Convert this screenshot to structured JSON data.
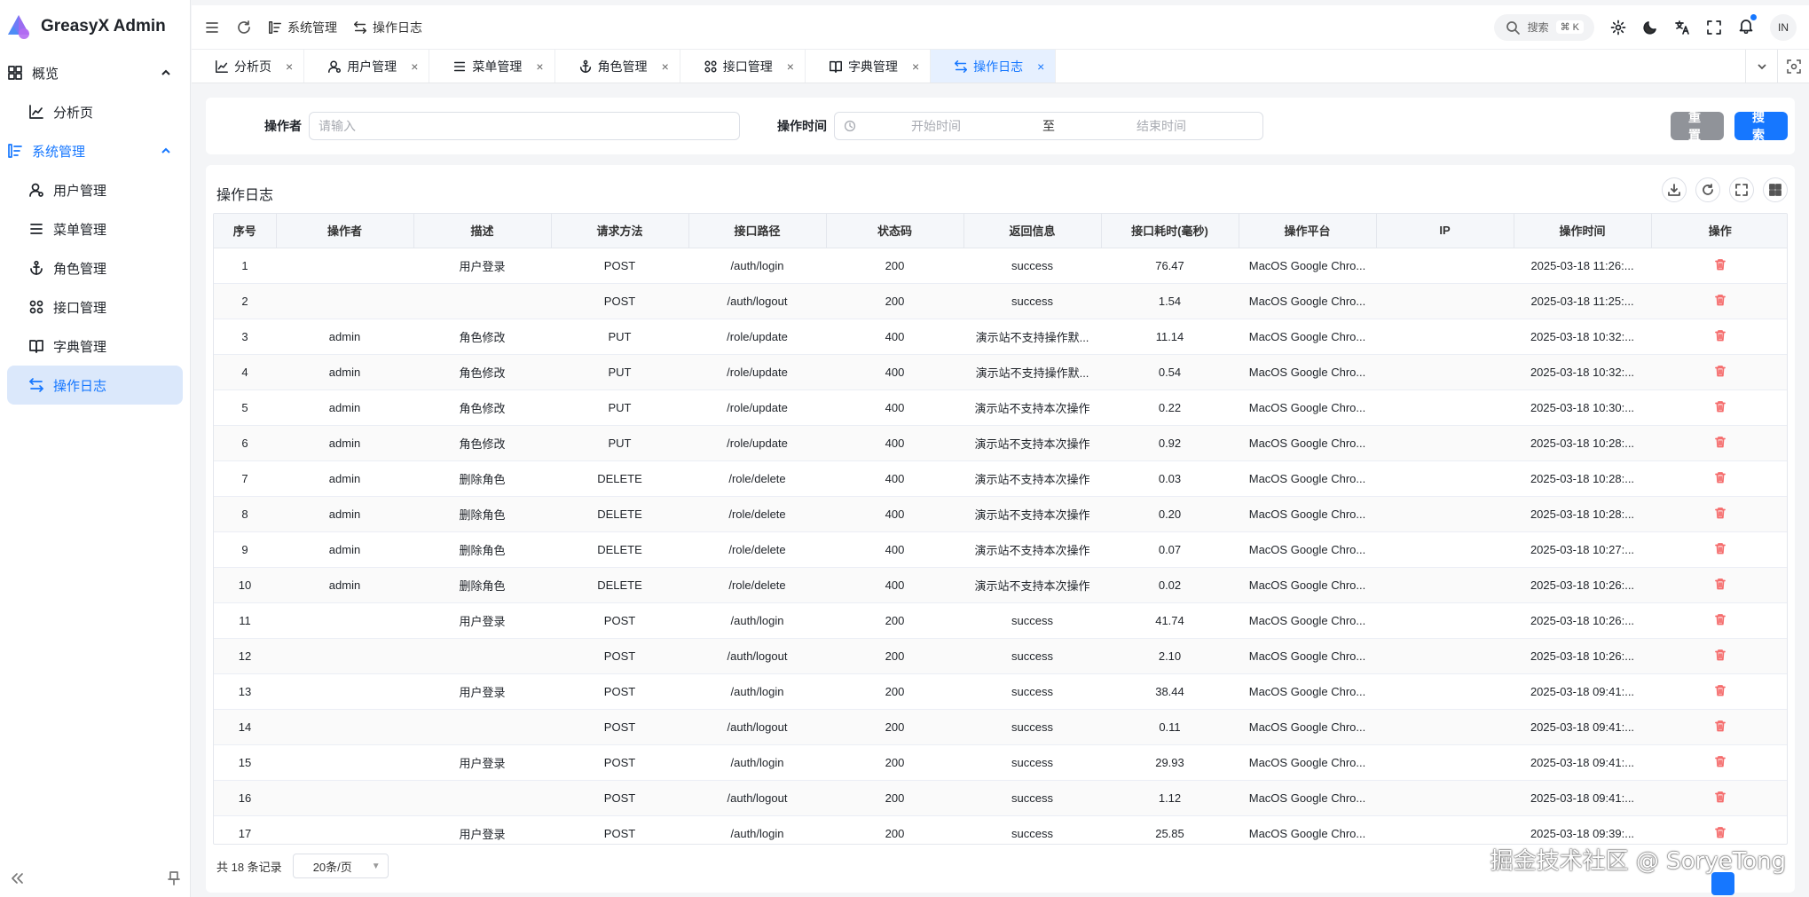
{
  "brand": {
    "name": "GreasyX Admin"
  },
  "sidebar": {
    "groups": [
      {
        "label": "概览",
        "icon": "dashboard-icon",
        "children": [
          {
            "label": "分析页",
            "icon": "chart-icon"
          }
        ]
      },
      {
        "label": "系统管理",
        "icon": "settings-list-icon",
        "children": [
          {
            "label": "用户管理",
            "icon": "user-icon"
          },
          {
            "label": "菜单管理",
            "icon": "menu-icon"
          },
          {
            "label": "角色管理",
            "icon": "anchor-icon"
          },
          {
            "label": "接口管理",
            "icon": "api-icon"
          },
          {
            "label": "字典管理",
            "icon": "book-icon"
          },
          {
            "label": "操作日志",
            "icon": "swap-icon"
          }
        ]
      }
    ]
  },
  "header": {
    "breadcrumb": [
      "系统管理",
      "操作日志"
    ],
    "search_label": "搜索",
    "search_shortcut": "⌘ K",
    "avatar_text": "IN"
  },
  "tabs": [
    {
      "label": "分析页",
      "icon": "chart-icon"
    },
    {
      "label": "用户管理",
      "icon": "user-icon"
    },
    {
      "label": "菜单管理",
      "icon": "menu-icon"
    },
    {
      "label": "角色管理",
      "icon": "anchor-icon"
    },
    {
      "label": "接口管理",
      "icon": "api-icon"
    },
    {
      "label": "字典管理",
      "icon": "book-icon"
    },
    {
      "label": "操作日志",
      "icon": "swap-icon",
      "active": true
    }
  ],
  "form": {
    "operator_label": "操作者",
    "operator_placeholder": "请输入",
    "time_label": "操作时间",
    "start_placeholder": "开始时间",
    "range_sep": "至",
    "end_placeholder": "结束时间",
    "reset_label": "重置",
    "search_label": "搜索"
  },
  "table": {
    "title": "操作日志",
    "columns": [
      "序号",
      "操作者",
      "描述",
      "请求方法",
      "接口路径",
      "状态码",
      "返回信息",
      "接口耗时(毫秒)",
      "操作平台",
      "IP",
      "操作时间",
      "操作"
    ],
    "rows": [
      [
        "1",
        "",
        "用户登录",
        "POST",
        "/auth/login",
        "200",
        "success",
        "76.47",
        "MacOS Google Chro...",
        "",
        "2025-03-18 11:26:..."
      ],
      [
        "2",
        "",
        "",
        "POST",
        "/auth/logout",
        "200",
        "success",
        "1.54",
        "MacOS Google Chro...",
        "",
        "2025-03-18 11:25:..."
      ],
      [
        "3",
        "admin",
        "角色修改",
        "PUT",
        "/role/update",
        "400",
        "演示站不支持操作默...",
        "11.14",
        "MacOS Google Chro...",
        "",
        "2025-03-18 10:32:..."
      ],
      [
        "4",
        "admin",
        "角色修改",
        "PUT",
        "/role/update",
        "400",
        "演示站不支持操作默...",
        "0.54",
        "MacOS Google Chro...",
        "",
        "2025-03-18 10:32:..."
      ],
      [
        "5",
        "admin",
        "角色修改",
        "PUT",
        "/role/update",
        "400",
        "演示站不支持本次操作",
        "0.22",
        "MacOS Google Chro...",
        "",
        "2025-03-18 10:30:..."
      ],
      [
        "6",
        "admin",
        "角色修改",
        "PUT",
        "/role/update",
        "400",
        "演示站不支持本次操作",
        "0.92",
        "MacOS Google Chro...",
        "",
        "2025-03-18 10:28:..."
      ],
      [
        "7",
        "admin",
        "删除角色",
        "DELETE",
        "/role/delete",
        "400",
        "演示站不支持本次操作",
        "0.03",
        "MacOS Google Chro...",
        "",
        "2025-03-18 10:28:..."
      ],
      [
        "8",
        "admin",
        "删除角色",
        "DELETE",
        "/role/delete",
        "400",
        "演示站不支持本次操作",
        "0.20",
        "MacOS Google Chro...",
        "",
        "2025-03-18 10:28:..."
      ],
      [
        "9",
        "admin",
        "删除角色",
        "DELETE",
        "/role/delete",
        "400",
        "演示站不支持本次操作",
        "0.07",
        "MacOS Google Chro...",
        "",
        "2025-03-18 10:27:..."
      ],
      [
        "10",
        "admin",
        "删除角色",
        "DELETE",
        "/role/delete",
        "400",
        "演示站不支持本次操作",
        "0.02",
        "MacOS Google Chro...",
        "",
        "2025-03-18 10:26:..."
      ],
      [
        "11",
        "",
        "用户登录",
        "POST",
        "/auth/login",
        "200",
        "success",
        "41.74",
        "MacOS Google Chro...",
        "",
        "2025-03-18 10:26:..."
      ],
      [
        "12",
        "",
        "",
        "POST",
        "/auth/logout",
        "200",
        "success",
        "2.10",
        "MacOS Google Chro...",
        "",
        "2025-03-18 10:26:..."
      ],
      [
        "13",
        "",
        "用户登录",
        "POST",
        "/auth/login",
        "200",
        "success",
        "38.44",
        "MacOS Google Chro...",
        "",
        "2025-03-18 09:41:..."
      ],
      [
        "14",
        "",
        "",
        "POST",
        "/auth/logout",
        "200",
        "success",
        "0.11",
        "MacOS Google Chro...",
        "",
        "2025-03-18 09:41:..."
      ],
      [
        "15",
        "",
        "用户登录",
        "POST",
        "/auth/login",
        "200",
        "success",
        "29.93",
        "MacOS Google Chro...",
        "",
        "2025-03-18 09:41:..."
      ],
      [
        "16",
        "",
        "",
        "POST",
        "/auth/logout",
        "200",
        "success",
        "1.12",
        "MacOS Google Chro...",
        "",
        "2025-03-18 09:41:..."
      ],
      [
        "17",
        "",
        "用户登录",
        "POST",
        "/auth/login",
        "200",
        "success",
        "25.85",
        "MacOS Google Chro...",
        "",
        "2025-03-18 09:39:..."
      ]
    ]
  },
  "pager": {
    "total_text": "共 18 条记录",
    "page_size": "20条/页"
  },
  "watermark": "掘金技术社区 @ SoryeTong",
  "colors": {
    "accent": "#1677ff",
    "danger": "#f56c6c",
    "reset": "#909399"
  }
}
